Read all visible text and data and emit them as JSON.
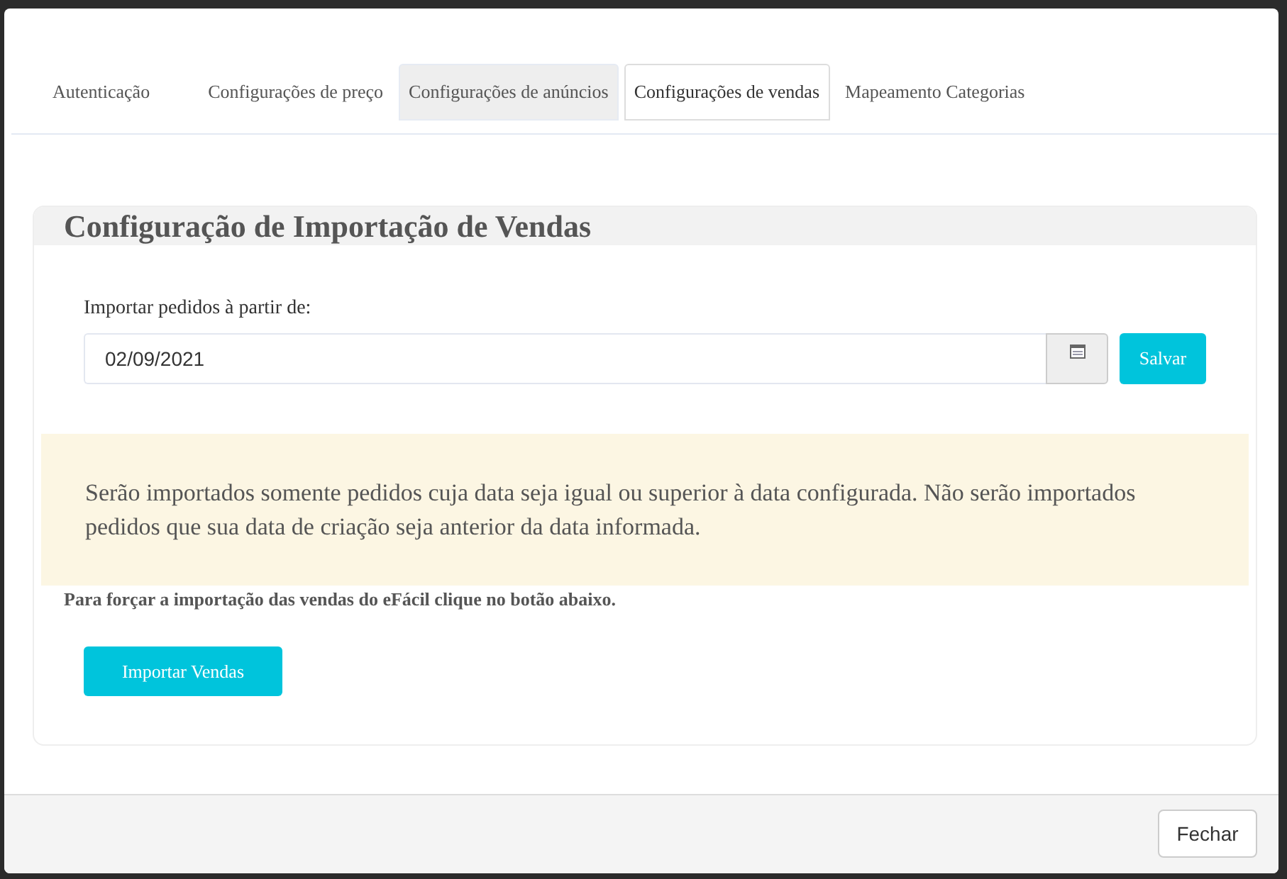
{
  "tabs": [
    {
      "label": "Autenticação",
      "selected": false,
      "highlighted": false
    },
    {
      "label": "Configurações de preço",
      "selected": false,
      "highlighted": false
    },
    {
      "label": "Configurações de anúncios",
      "selected": false,
      "highlighted": true
    },
    {
      "label": "Configurações de vendas",
      "selected": true,
      "highlighted": false
    },
    {
      "label": "Mapeamento Categorias",
      "selected": false,
      "highlighted": false
    }
  ],
  "panel": {
    "title": "Configuração de Importação de Vendas",
    "date_field": {
      "label": "Importar pedidos à partir de:",
      "value": "02/09/2021"
    },
    "save_button": "Salvar",
    "alert": "Serão importados somente pedidos cuja data seja igual ou superior à data configurada. Não serão importados pedidos que sua data de criação seja anterior da data informada.",
    "force_note": "Para forçar a importação das vendas do eFácil clique no botão abaixo.",
    "import_button": "Importar Vendas"
  },
  "footer": {
    "close_button": "Fechar"
  }
}
